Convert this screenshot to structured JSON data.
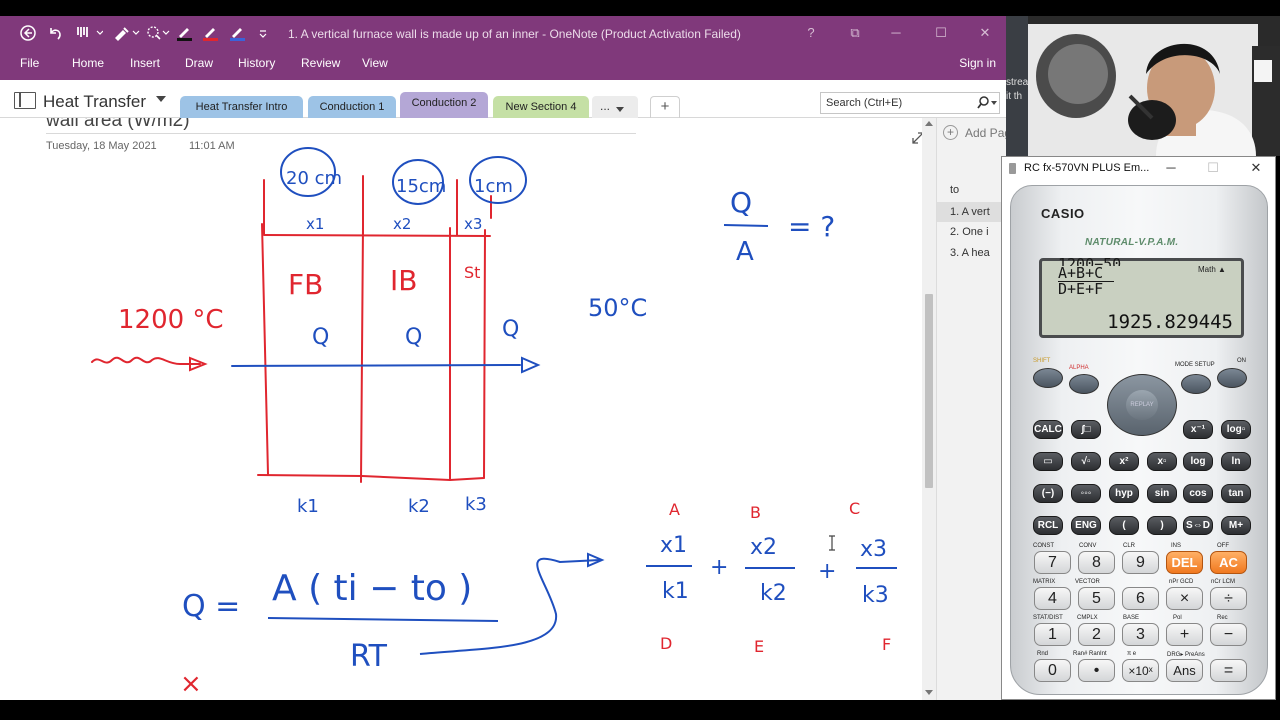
{
  "onenote": {
    "window_title": "1. A vertical furnace wall is made up of an inner  - OneNote (Product Activation Failed)",
    "ribbon_tabs": [
      "File",
      "Home",
      "Insert",
      "Draw",
      "History",
      "Review",
      "View"
    ],
    "sign_in": "Sign in",
    "window_controls": [
      "?",
      "⧉",
      "─",
      "☐",
      "✕"
    ],
    "notebook_name": "Heat Transfer",
    "section_tabs": [
      {
        "label": "Heat Transfer Intro",
        "color": "#9dc3e6"
      },
      {
        "label": "Conduction 1",
        "color": "#9dc3e6"
      },
      {
        "label": "Conduction 2",
        "color": "#b4a7d6",
        "active": true
      },
      {
        "label": "New Section 4",
        "color": "#c5e0a5"
      }
    ],
    "more_tabs": "...",
    "add_tab": "+",
    "search_placeholder": "Search (Ctrl+E)",
    "page": {
      "title_fragment": "wall area (W/m2)",
      "date": "Tuesday, 18 May 2021",
      "time": "11:01 AM"
    },
    "page_pane": {
      "add_page": "Add Page",
      "heading": "to",
      "pages": [
        "1. A vert",
        "2. One i",
        "3. A hea"
      ]
    },
    "ink": {
      "thickness_labels": [
        "20 cm",
        "15cm",
        "1cm"
      ],
      "layer_x_labels": [
        "x1",
        "x2",
        "x3"
      ],
      "layer_names": [
        "FB",
        "IB",
        "St"
      ],
      "heat_flow_labels": [
        "Q",
        "Q",
        "Q"
      ],
      "conductivity_labels": [
        "k1",
        "k2",
        "k3"
      ],
      "hot_temp": "1200 °C",
      "cold_temp": "50°C",
      "q_over_a": {
        "num": "Q",
        "den": "A",
        "rhs": "= ?"
      },
      "formula": {
        "lhs": "Q =",
        "numerator": "A ( ti − to )",
        "denominator": "RT"
      },
      "resistance_sum": {
        "top_letters": [
          "A",
          "B",
          "C"
        ],
        "terms": [
          {
            "num": "x1",
            "den": "k1"
          },
          {
            "num": "x2",
            "den": "k2"
          },
          {
            "num": "x3",
            "den": "k3"
          }
        ],
        "plus": "+",
        "bottom_letters": [
          "D",
          "E",
          "F"
        ]
      },
      "stray_mark": "×"
    },
    "colors": {
      "ribbon": "#80397b",
      "ink_blue": "#1f4fbf",
      "ink_red": "#e0262f"
    }
  },
  "webcam": {
    "visible_text": [
      "strea",
      "it th"
    ]
  },
  "calculator": {
    "window_title": "RC fx-570VN PLUS Em...",
    "window_controls": [
      "─",
      "☐",
      "✕"
    ],
    "brand": "CASIO",
    "series": "NATURAL-V.P.A.M.",
    "display": {
      "cut_line": "1200−50",
      "expression_top": "A+B+C",
      "expression_bottom": "D+E+F",
      "mode_indicator": "Math ▲",
      "value": "1925.829445"
    },
    "function_labels": {
      "shift": "SHIFT",
      "alpha": "ALPHA",
      "mode": "MODE SETUP",
      "on": "ON",
      "replay": "REPLAY"
    },
    "keys_row1": [
      "CALC",
      "∫□",
      "x⁻¹",
      "log▫"
    ],
    "keys_row2": [
      "▭",
      "√▫",
      "x²",
      "x▫",
      "log",
      "ln"
    ],
    "keys_row3": [
      "(−)",
      "◦◦◦",
      "hyp",
      "sin",
      "cos",
      "tan"
    ],
    "keys_row4": [
      "RCL",
      "ENG",
      "(",
      ")",
      "S⇔D",
      "M+"
    ],
    "numpad": [
      [
        "7",
        "8",
        "9",
        "DEL",
        "AC"
      ],
      [
        "4",
        "5",
        "6",
        "×",
        "÷"
      ],
      [
        "1",
        "2",
        "3",
        "+",
        "−"
      ],
      [
        "0",
        "•",
        "×10ˣ",
        "Ans",
        "="
      ]
    ],
    "shift_labels_numpad": [
      [
        "CONST",
        "CONV",
        "CLR",
        "INS",
        "OFF"
      ],
      [
        "MATRIX",
        "VECTOR",
        "",
        "nPr GCD",
        "nCr LCM"
      ],
      [
        "STAT/DIST",
        "CMPLX",
        "BASE",
        "Pol",
        "Rec"
      ],
      [
        "Rnd",
        "Ran# RanInt",
        "π e",
        "DRG▸ PreAns",
        ""
      ]
    ]
  }
}
